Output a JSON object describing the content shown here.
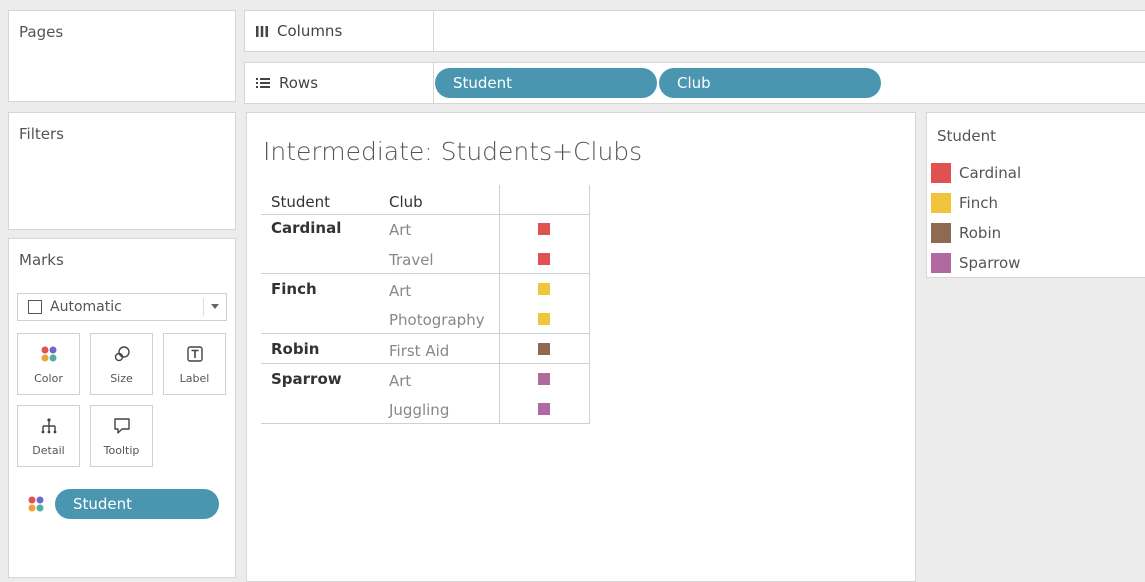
{
  "pages": {
    "title": "Pages"
  },
  "filters": {
    "title": "Filters"
  },
  "columns_shelf": {
    "label": "Columns",
    "icon": "columns-icon"
  },
  "rows_shelf": {
    "label": "Rows",
    "icon": "rows-icon",
    "pills": [
      "Student",
      "Club"
    ]
  },
  "marks": {
    "title": "Marks",
    "mark_type": "Automatic",
    "buttons": [
      {
        "label": "Color",
        "icon": "color-icon"
      },
      {
        "label": "Size",
        "icon": "size-icon"
      },
      {
        "label": "Label",
        "icon": "label-icon"
      },
      {
        "label": "Detail",
        "icon": "detail-icon"
      },
      {
        "label": "Tooltip",
        "icon": "tooltip-icon"
      }
    ],
    "color_pill": "Student"
  },
  "view": {
    "title": "Intermediate: Students+Clubs",
    "headers": {
      "student": "Student",
      "club": "Club"
    },
    "rows": [
      {
        "student": "Cardinal",
        "clubs": [
          "Art",
          "Travel"
        ],
        "color": "#e05252"
      },
      {
        "student": "Finch",
        "clubs": [
          "Art",
          "Photography"
        ],
        "color": "#f0c43c"
      },
      {
        "student": "Robin",
        "clubs": [
          "First Aid"
        ],
        "color": "#8f6a52"
      },
      {
        "student": "Sparrow",
        "clubs": [
          "Art",
          "Juggling"
        ],
        "color": "#b06aa0"
      }
    ]
  },
  "legend": {
    "title": "Student",
    "items": [
      {
        "label": "Cardinal",
        "color": "#e05252"
      },
      {
        "label": "Finch",
        "color": "#f0c43c"
      },
      {
        "label": "Robin",
        "color": "#8f6a52"
      },
      {
        "label": "Sparrow",
        "color": "#b06aa0"
      }
    ]
  }
}
